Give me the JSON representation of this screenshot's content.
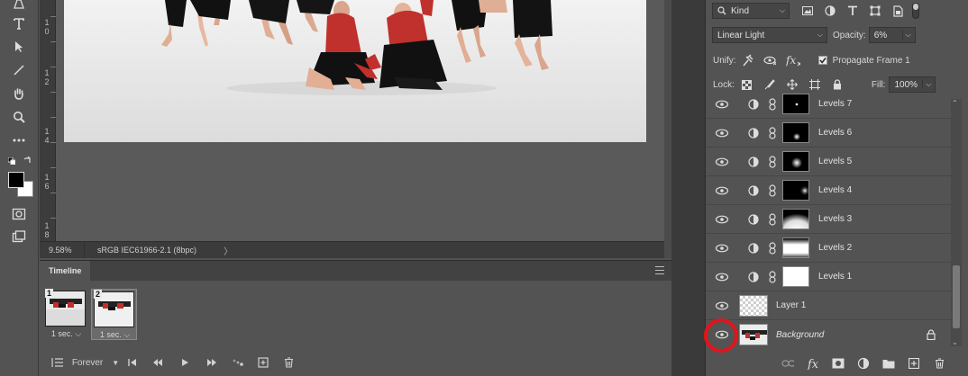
{
  "ruler": {
    "numbers": [
      "1",
      "0",
      "1",
      "2",
      "1",
      "4",
      "1",
      "6",
      "1",
      "8"
    ]
  },
  "status_bar": {
    "zoom": "9.58%",
    "color_profile": "sRGB IEC61966-2.1 (8bpc)",
    "arrow": "〉"
  },
  "timeline": {
    "tab_label": "Timeline",
    "frames": [
      {
        "number": "1",
        "delay": "1 sec.",
        "selected": false
      },
      {
        "number": "2",
        "delay": "1 sec.",
        "selected": true
      }
    ],
    "loop_option": "Forever"
  },
  "layers_panel": {
    "filter_kind": "Kind",
    "blend_mode": "Linear Light",
    "opacity_label": "Opacity:",
    "opacity_value": "6%",
    "unify_label": "Unify:",
    "propagate_label": "Propagate Frame 1",
    "propagate_checked": true,
    "lock_label": "Lock:",
    "fill_label": "Fill:",
    "fill_value": "100%",
    "layers": [
      {
        "name": "Levels 7",
        "type": "adjustment",
        "mask": "tiny-dot",
        "visible": true
      },
      {
        "name": "Levels 6",
        "type": "adjustment",
        "mask": "small-glow",
        "visible": true
      },
      {
        "name": "Levels 5",
        "type": "adjustment",
        "mask": "glow",
        "visible": true
      },
      {
        "name": "Levels 4",
        "type": "adjustment",
        "mask": "edge-glow",
        "visible": true
      },
      {
        "name": "Levels 3",
        "type": "adjustment",
        "mask": "bottom-glow",
        "visible": true
      },
      {
        "name": "Levels 2",
        "type": "adjustment",
        "mask": "band",
        "visible": true
      },
      {
        "name": "Levels 1",
        "type": "adjustment",
        "mask": "white",
        "visible": true
      },
      {
        "name": "Layer 1",
        "type": "pixel",
        "visible": true
      },
      {
        "name": "Background",
        "type": "background",
        "visible": true,
        "locked": true
      }
    ]
  },
  "colors": {
    "highlight": "#e3131b",
    "panel_bg": "#535353",
    "accent_red": "#c0302c"
  }
}
